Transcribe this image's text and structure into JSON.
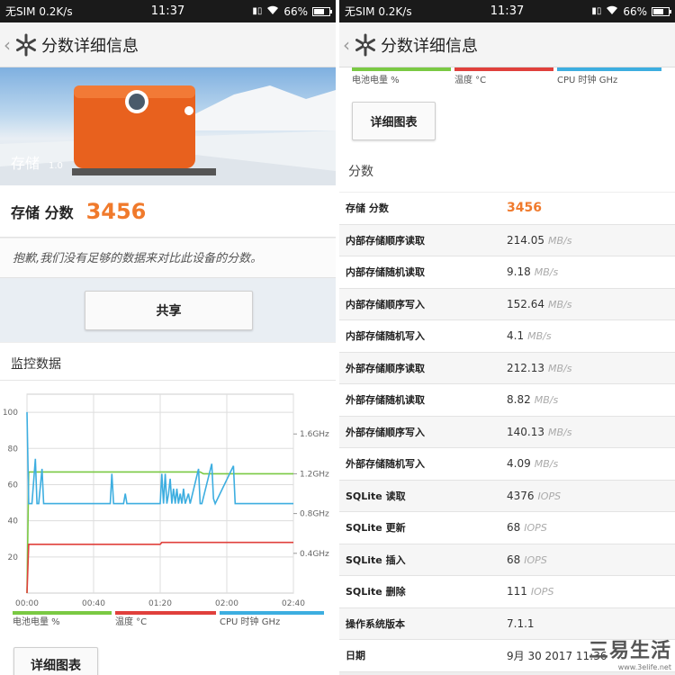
{
  "status": {
    "carrier": "无SIM 0.2K/s",
    "time": "11:37",
    "battery": "66%",
    "battery_level": 0.66
  },
  "header": {
    "title": "分数详细信息"
  },
  "hero": {
    "label": "存储",
    "version": "1.0"
  },
  "score": {
    "label": "存储 分数",
    "value": "3456"
  },
  "notice": "抱歉,我们没有足够的数据来对比此设备的分数。",
  "share_label": "共享",
  "monitor_title": "监控数据",
  "detail_chart_label": "详细图表",
  "section_score": "分数",
  "colors": {
    "accent": "#f07a2c",
    "battery": "#7ac943",
    "temp": "#e0403c",
    "cpu": "#3daee0"
  },
  "legend": [
    {
      "label": "电池电量 %",
      "color": "#7ac943"
    },
    {
      "label": "温度 °C",
      "color": "#e0403c"
    },
    {
      "label": "CPU 时钟 GHz",
      "color": "#3daee0"
    }
  ],
  "chart_data": {
    "type": "line",
    "x_ticks": [
      "00:00",
      "00:40",
      "01:20",
      "02:00",
      "02:40"
    ],
    "y_left_ticks": [
      "100",
      "80",
      "60",
      "40",
      "20"
    ],
    "y_right_ticks": [
      "1.6GHz",
      "1.2GHz",
      "0.8GHz",
      "0.4GHz"
    ],
    "ylim_left": [
      0,
      110
    ],
    "ylim_right": [
      0,
      2.0
    ],
    "xlim_minutes": [
      0,
      160
    ],
    "series": [
      {
        "name": "电池电量 %",
        "axis": "left",
        "x": [
          0,
          1,
          5,
          40,
          80,
          104,
          106,
          160
        ],
        "y": [
          0,
          67,
          67,
          67,
          67,
          67,
          66,
          66
        ]
      },
      {
        "name": "温度 °C",
        "axis": "left",
        "x": [
          0,
          1,
          40,
          80,
          81,
          160
        ],
        "y": [
          0,
          27,
          27,
          27,
          28,
          28
        ]
      },
      {
        "name": "CPU 时钟 GHz",
        "axis": "right",
        "x": [
          0,
          1,
          2,
          3,
          5,
          6,
          7,
          9,
          10,
          11,
          50,
          51,
          52,
          58,
          59,
          60,
          80,
          81,
          82,
          83,
          84,
          85,
          86,
          87,
          88,
          89,
          90,
          91,
          92,
          93,
          94,
          95,
          96,
          97,
          98,
          103,
          104,
          105,
          111,
          112,
          113,
          124,
          125,
          126,
          160
        ],
        "y": [
          1.82,
          0.9,
          0.9,
          0.9,
          1.35,
          0.9,
          0.9,
          1.25,
          0.9,
          0.9,
          0.9,
          1.2,
          0.9,
          0.9,
          1.0,
          0.9,
          0.9,
          1.2,
          0.9,
          1.2,
          0.9,
          1.0,
          1.15,
          0.9,
          1.05,
          0.9,
          1.05,
          0.9,
          1.0,
          0.9,
          1.05,
          0.9,
          0.95,
          1.0,
          0.9,
          1.25,
          0.9,
          0.9,
          1.3,
          0.95,
          0.9,
          1.28,
          0.9,
          0.9,
          0.9
        ]
      }
    ]
  },
  "results": [
    {
      "key": "存储 分数",
      "value": "3456",
      "unit": "",
      "highlight": true
    },
    {
      "key": "内部存储顺序读取",
      "value": "214.05",
      "unit": "MB/s"
    },
    {
      "key": "内部存储随机读取",
      "value": "9.18",
      "unit": "MB/s"
    },
    {
      "key": "内部存储顺序写入",
      "value": "152.64",
      "unit": "MB/s"
    },
    {
      "key": "内部存储随机写入",
      "value": "4.1",
      "unit": "MB/s"
    },
    {
      "key": "外部存储顺序读取",
      "value": "212.13",
      "unit": "MB/s"
    },
    {
      "key": "外部存储随机读取",
      "value": "8.82",
      "unit": "MB/s"
    },
    {
      "key": "外部存储顺序写入",
      "value": "140.13",
      "unit": "MB/s"
    },
    {
      "key": "外部存储随机写入",
      "value": "4.09",
      "unit": "MB/s"
    },
    {
      "key": "SQLite 读取",
      "value": "4376",
      "unit": "IOPS"
    },
    {
      "key": "SQLite 更新",
      "value": "68",
      "unit": "IOPS"
    },
    {
      "key": "SQLite 插入",
      "value": "68",
      "unit": "IOPS"
    },
    {
      "key": "SQLite 删除",
      "value": "111",
      "unit": "IOPS"
    },
    {
      "key": "操作系统版本",
      "value": "7.1.1",
      "unit": ""
    },
    {
      "key": "日期",
      "value": "9月 30 2017 11:36",
      "unit": ""
    }
  ],
  "watermark": {
    "main": "三易生活",
    "sub": "www.3elife.net"
  }
}
